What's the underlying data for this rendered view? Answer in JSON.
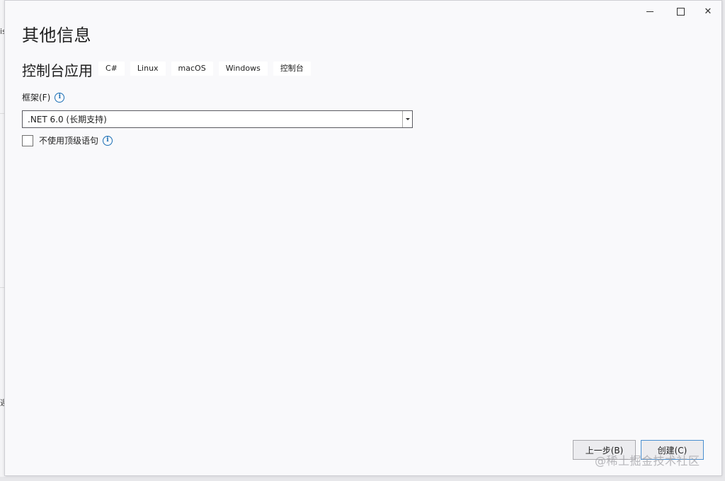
{
  "window": {
    "title": "其他信息",
    "minimize_icon": "minimize-icon",
    "maximize_icon": "maximize-icon",
    "close_icon": "close-icon",
    "close_glyph": "✕"
  },
  "template": {
    "name": "控制台应用",
    "tags": [
      "C#",
      "Linux",
      "macOS",
      "Windows",
      "控制台"
    ]
  },
  "framework": {
    "label": "框架(F)",
    "info_glyph": "i",
    "selected": ".NET 6.0 (长期支持)"
  },
  "top_level_statements": {
    "label": "不使用顶级语句",
    "checked": false,
    "info_glyph": "i"
  },
  "buttons": {
    "back": "上一步(B)",
    "create": "创建(C)"
  },
  "watermark": "@稀土掘金技术社区",
  "backdrop": {
    "glyph_top": "is",
    "glyph_bottom": "週"
  },
  "colors": {
    "accent": "#1a6fb5",
    "dialog_background": "#f9f9fb"
  }
}
